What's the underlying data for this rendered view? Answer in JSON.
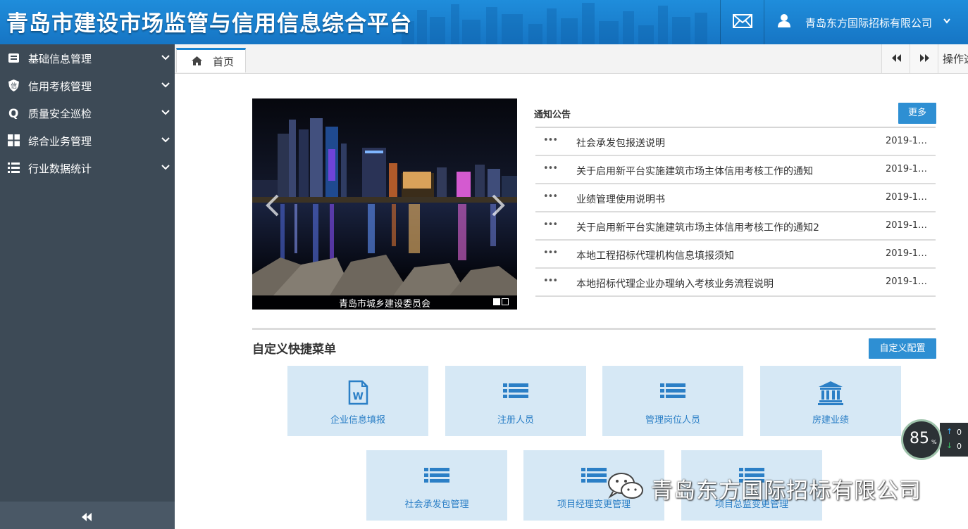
{
  "header": {
    "title": "青岛市建设市场监管与信用信息综合平台",
    "company": "青岛东方国际招标有限公司",
    "icons": [
      "mail-icon",
      "user-icon",
      "chevron-down-icon"
    ]
  },
  "sidebar": {
    "items": [
      {
        "label": "基础信息管理",
        "icon": "card-icon"
      },
      {
        "label": "信用考核管理",
        "icon": "shield-icon"
      },
      {
        "label": "质量安全巡检",
        "icon": "q-icon"
      },
      {
        "label": "综合业务管理",
        "icon": "grid-icon"
      },
      {
        "label": "行业数据统计",
        "icon": "list-icon"
      }
    ]
  },
  "tabs": {
    "home_label": "首页",
    "ops_label": "操作选"
  },
  "carousel": {
    "caption": "青岛市城乡建设委员会"
  },
  "notices": {
    "title": "通知公告",
    "more_label": "更多",
    "items": [
      {
        "text": "社会承发包报送说明",
        "date": "2019-1…"
      },
      {
        "text": "关于启用新平台实施建筑市场主体信用考核工作的通知",
        "date": "2019-1…"
      },
      {
        "text": "业绩管理使用说明书",
        "date": "2019-1…"
      },
      {
        "text": "关于启用新平台实施建筑市场主体信用考核工作的通知2",
        "date": "2019-1…"
      },
      {
        "text": "本地工程招标代理机构信息填报须知",
        "date": "2019-1…"
      },
      {
        "text": "本地招标代理企业办理纳入考核业务流程说明",
        "date": "2019-1…"
      }
    ],
    "dots": "•••"
  },
  "shortcuts": {
    "title": "自定义快捷菜单",
    "config_label": "自定义配置",
    "tiles": [
      {
        "label": "企业信息填报",
        "icon": "word-doc-icon"
      },
      {
        "label": "注册人员",
        "icon": "list-icon"
      },
      {
        "label": "管理岗位人员",
        "icon": "list-icon"
      },
      {
        "label": "房建业绩",
        "icon": "bank-building-icon"
      },
      {
        "label": "社会承发包管理",
        "icon": "list-icon"
      },
      {
        "label": "项目经理变更管理",
        "icon": "list-icon"
      },
      {
        "label": "项目总监变更管理",
        "icon": "list-icon"
      }
    ]
  },
  "watermark": {
    "text": "青岛东方国际招标有限公司"
  },
  "speed": {
    "value": "85",
    "unit": "%",
    "up": "0",
    "down": "0"
  },
  "colors": {
    "header_blue": "#1b82d0",
    "sidebar": "#3d4a56",
    "accent": "#2e8fd3",
    "tile_bg": "#d6e8f5"
  }
}
